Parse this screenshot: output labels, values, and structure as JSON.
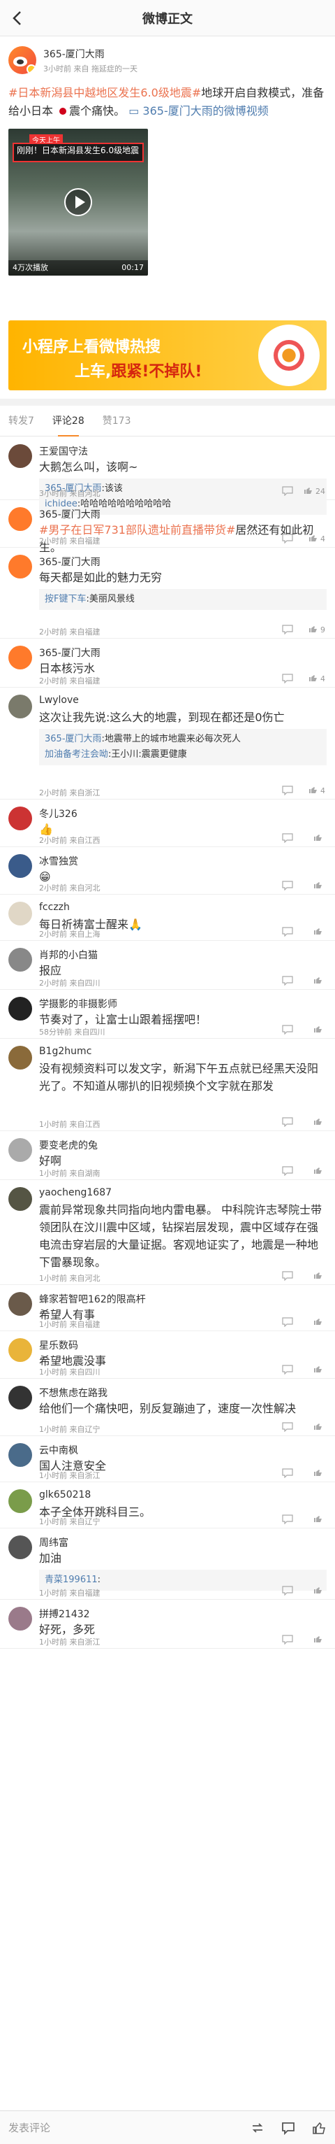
{
  "header": {
    "title": "微博正文"
  },
  "post": {
    "author": "365-厦门大雨",
    "meta": "3小时前  来自 拖延症的一天",
    "text_parts": {
      "t1": "#日本新潟县中越地区发生6.0级地震#",
      "t2": "地球开启自救模式，准备给小日本",
      "t3": "震个痛快。",
      "t4": "365-厦门大雨的微博视频"
    },
    "video": {
      "tag": "今天上午",
      "title": "刚刚！日本新潟县发生6.0级地震",
      "views": "4万次播放",
      "duration": "00:17"
    }
  },
  "ad": {
    "line1": "小程序上看微博热搜",
    "line2_a": "上车,",
    "line2_b": "跟紧!不掉队!"
  },
  "tabs": {
    "repost": "转发7",
    "comment": "评论28",
    "like": "赞173"
  },
  "comments": [
    {
      "name": "王爱国守法",
      "text": "大鹅怎么叫，该啊~",
      "time": "3小时前 来自河北",
      "likes": "24",
      "subs": [
        {
          "user": "365-厦门大雨",
          "text": ":该该"
        },
        {
          "user": "ichidee",
          "text": ":哈哈哈哈哈哈哈哈哈哈"
        }
      ]
    },
    {
      "name": "365-厦门大雨",
      "text_hl": "#男子在日军731部队遗址前直播带货#",
      "text": "居然还有如此初生。",
      "time": "2小时前 来自福建",
      "likes": "4"
    },
    {
      "name": "365-厦门大雨",
      "text": "每天都是如此的魅力无穷",
      "time": "2小时前 来自福建",
      "likes": "9",
      "subs": [
        {
          "user": "按F键下车",
          "text": ":美丽风景线"
        }
      ]
    },
    {
      "name": "365-厦门大雨",
      "text": "日本核污水",
      "time": "2小时前 来自福建",
      "likes": "4"
    },
    {
      "name": "Lwylove",
      "text": "这次让我先说:这么大的地震，到现在都还是0伤亡",
      "time": "2小时前 来自浙江",
      "likes": "4",
      "subs": [
        {
          "user": "365-厦门大雨",
          "text": ":地震带上的城市地震来必每次死人"
        },
        {
          "user": "加油备考注会呦",
          "text": ":王小川:震震更健康"
        }
      ]
    },
    {
      "name": "冬儿326",
      "text": "👍",
      "time": "2小时前 来自江西",
      "likes": ""
    },
    {
      "name": "冰雪独赏",
      "text": "😁",
      "time": "2小时前 来自河北",
      "likes": ""
    },
    {
      "name": "fcczzh",
      "text": "每日祈祷富士醒来🙏",
      "time": "2小时前 来自上海",
      "likes": ""
    },
    {
      "name": "肖邦的小白猫",
      "text": "报应",
      "time": "2小时前 来自四川",
      "likes": ""
    },
    {
      "name": "学摄影的非摄影师",
      "text": "节奏对了，让富士山跟着摇摆吧！",
      "time": "58分钟前 来自四川",
      "likes": ""
    },
    {
      "name": "B1g2humc",
      "text": "没有视频资料可以发文字，新潟下午五点就已经黑天没阳光了。不知道从哪扒的旧视频换个文字就在那发",
      "time": "1小时前 来自江西",
      "likes": ""
    },
    {
      "name": "要变老虎的兔",
      "text": "好啊",
      "time": "1小时前 来自湖南",
      "likes": ""
    },
    {
      "name": "yaocheng1687",
      "text": "震前异常现象共同指向地内雷电暴。 中科院许志琴院士带领团队在汶川震中区域，钻探岩层发现，震中区域存在强电流击穿岩层的大量证据。客观地证实了，地震是一种地下雷暴现象。",
      "time": "1小时前 来自河北",
      "likes": ""
    },
    {
      "name": "蜂家若智吧162的限高杆",
      "text": "希望人有事",
      "time": "1小时前 来自福建",
      "likes": ""
    },
    {
      "name": "星乐数码",
      "text": "希望地震没事",
      "time": "1小时前 来自四川",
      "likes": ""
    },
    {
      "name": "不想焦虑在路我",
      "text": "给他们一个痛快吧，别反复蹦迪了，速度一次性解决",
      "time": "1小时前 来自辽宁",
      "likes": ""
    },
    {
      "name": "云中南枫",
      "text": "国人注意安全",
      "time": "1小时前 来自浙江",
      "likes": ""
    },
    {
      "name": "glk650218",
      "text": "本子全体开跳科目三。",
      "time": "1小时前 来自辽宁",
      "likes": ""
    },
    {
      "name": "周纬富",
      "text": "加油",
      "time": "1小时前 来自福建",
      "likes": "",
      "subs": [
        {
          "user": "青菜199611",
          "text": ":"
        }
      ]
    },
    {
      "name": "拼搏21432",
      "text": "好死，多死",
      "time": "1小时前 来自浙江",
      "likes": ""
    }
  ],
  "bottom": {
    "placeholder": "发表评论"
  }
}
